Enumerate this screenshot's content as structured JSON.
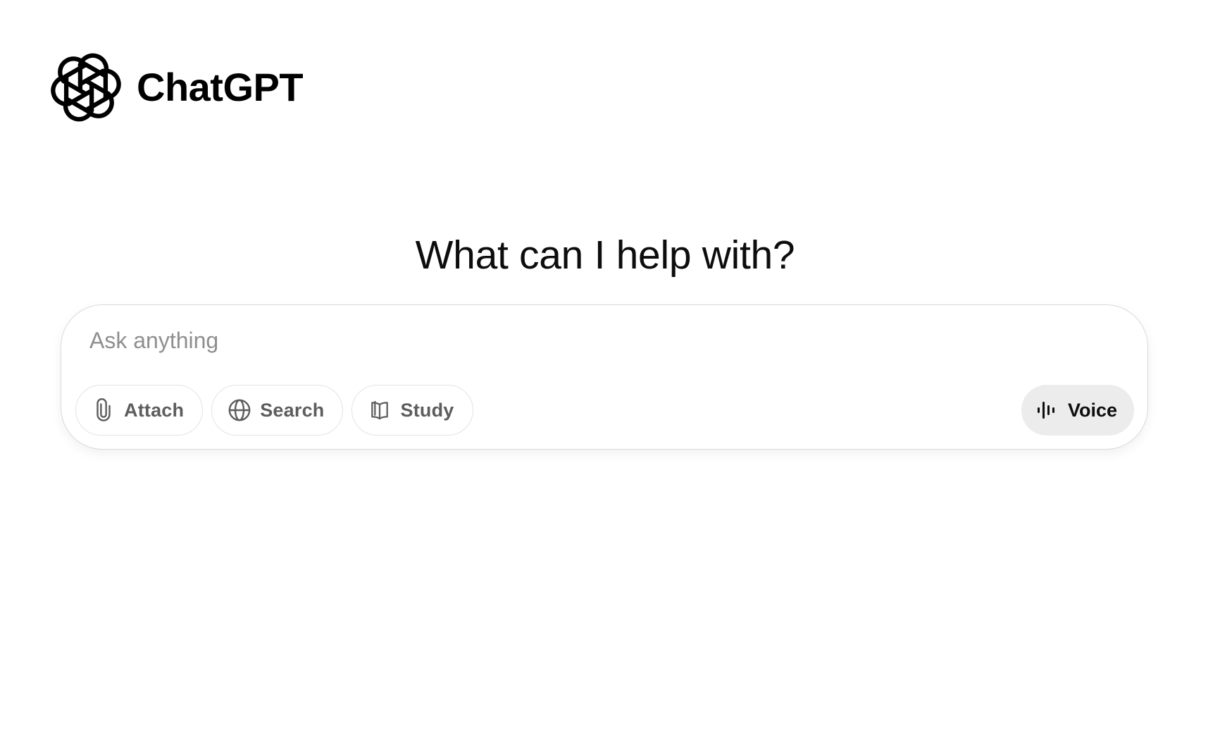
{
  "brand": {
    "logo_icon": "openai-logo-icon",
    "name": "ChatGPT"
  },
  "headline": "What can I help with?",
  "composer": {
    "placeholder": "Ask anything",
    "value": "",
    "tools": [
      {
        "label": "Attach",
        "icon": "paperclip-icon"
      },
      {
        "label": "Search",
        "icon": "globe-icon"
      },
      {
        "label": "Study",
        "icon": "open-book-icon"
      }
    ],
    "voice": {
      "label": "Voice",
      "icon": "voice-waveform-icon"
    }
  },
  "colors": {
    "background": "#ffffff",
    "text": "#0d0d0d",
    "placeholder": "#8f8f8f",
    "pill_border": "#e3e3e3",
    "pill_text": "#5d5d5d",
    "voice_bg": "#ececec"
  }
}
